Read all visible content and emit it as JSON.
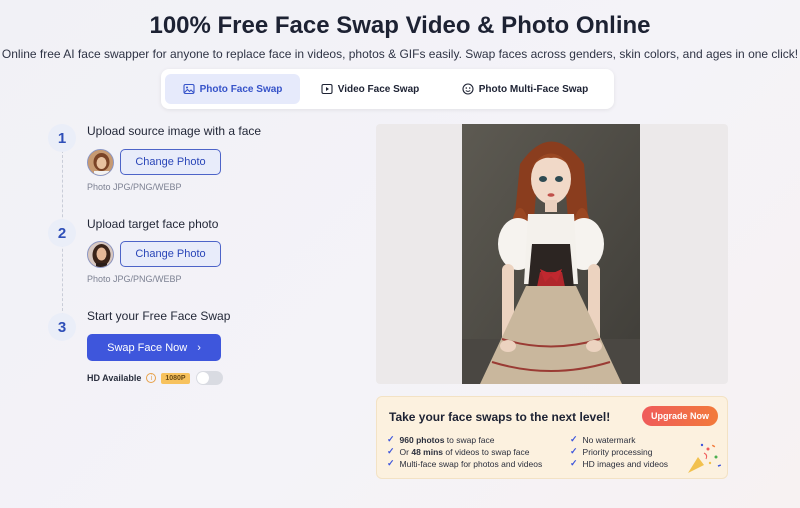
{
  "header": {
    "title": "100% Free Face Swap Video & Photo Online",
    "subtitle": "Online free AI face swapper for anyone to replace face in videos, photos & GIFs easily. Swap faces across genders, skin colors, and ages in one click!"
  },
  "tabs": [
    {
      "label": "Photo Face Swap",
      "icon": "image-icon",
      "active": true
    },
    {
      "label": "Video Face Swap",
      "icon": "video-icon",
      "active": false
    },
    {
      "label": "Photo Multi-Face Swap",
      "icon": "multi-face-icon",
      "active": false
    }
  ],
  "steps": [
    {
      "num": "1",
      "title": "Upload source image with a face",
      "button": "Change Photo",
      "hint": "Photo JPG/PNG/WEBP"
    },
    {
      "num": "2",
      "title": "Upload target face photo",
      "button": "Change Photo",
      "hint": "Photo JPG/PNG/WEBP"
    },
    {
      "num": "3",
      "title": "Start your Free Face Swap",
      "button": "Swap Face Now"
    }
  ],
  "hd": {
    "label": "HD Available",
    "badge": "1080P",
    "toggle_on": false
  },
  "promo": {
    "title": "Take your face swaps to the next level!",
    "button": "Upgrade Now",
    "features_left": [
      {
        "bold": "960 photos",
        "rest": " to swap face",
        "prefix": ""
      },
      {
        "prefix": "Or ",
        "bold": "48 mins",
        "rest": " of videos to swap face"
      },
      {
        "prefix": "",
        "bold": "",
        "rest": "Multi-face swap for photos and videos"
      }
    ],
    "features_right": [
      "No watermark",
      "Priority processing",
      "HD images and videos"
    ]
  },
  "colors": {
    "accent": "#3e56dc",
    "upgrade_start": "#ef5b5b",
    "upgrade_end": "#f27a3a",
    "promo_bg": "#fcf1df"
  }
}
